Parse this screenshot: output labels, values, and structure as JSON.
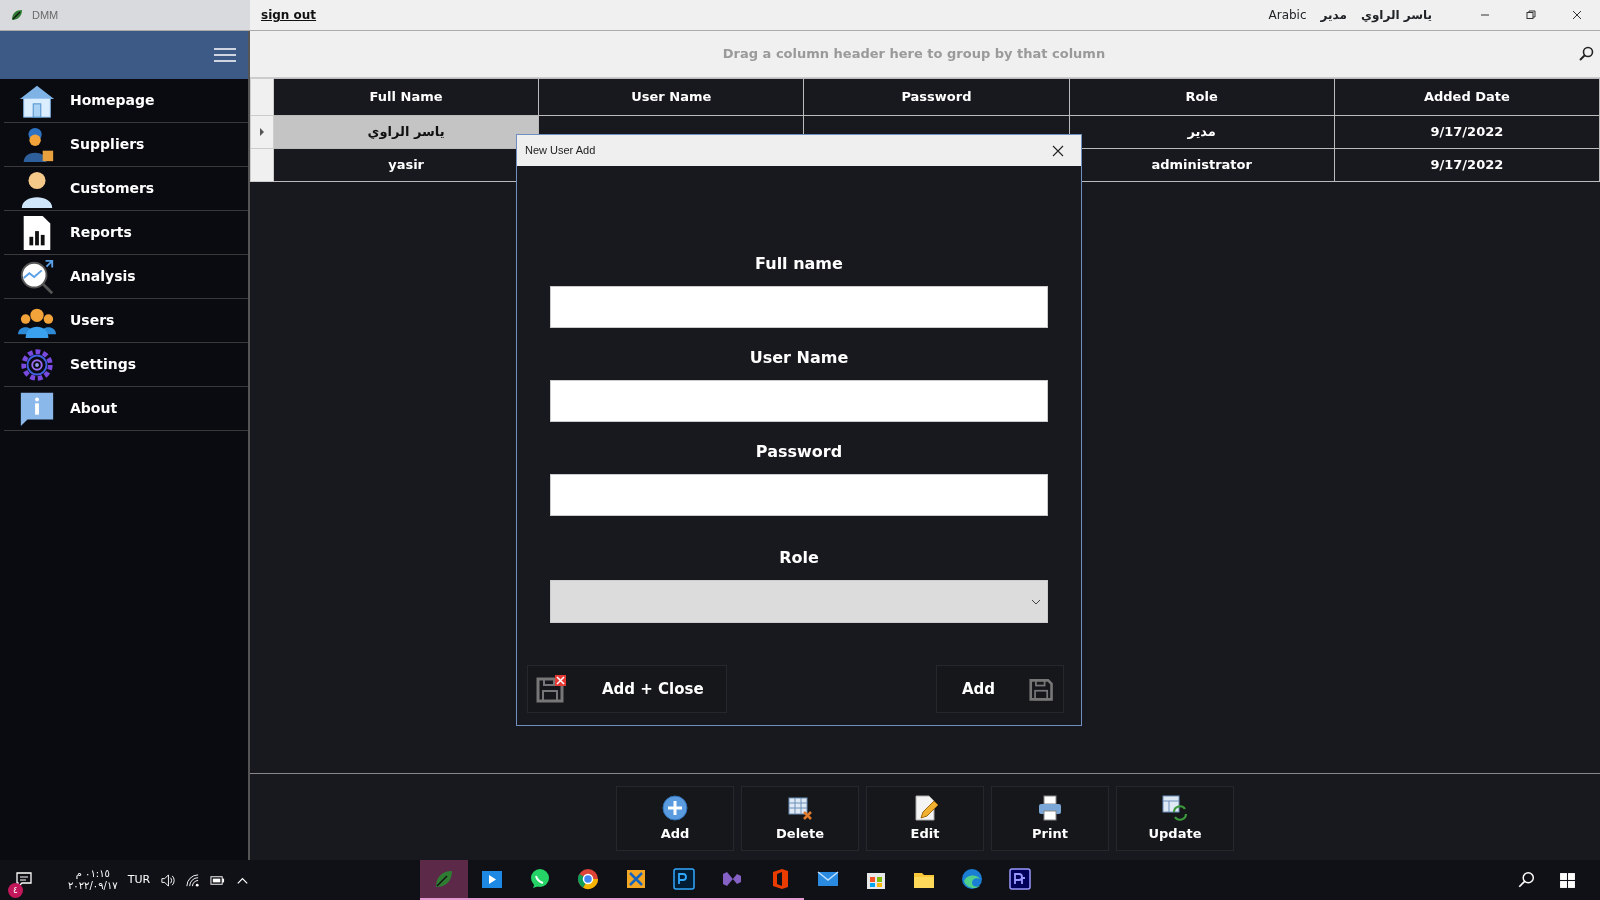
{
  "title_bar": {
    "app_name": "DMM",
    "sign_out": "sign out",
    "language": "Arabic",
    "role": "مدير",
    "user": "ياسر الراوي"
  },
  "sidebar": {
    "items": [
      {
        "label": "Homepage"
      },
      {
        "label": "Suppliers"
      },
      {
        "label": "Customers"
      },
      {
        "label": "Reports"
      },
      {
        "label": "Analysis"
      },
      {
        "label": "Users"
      },
      {
        "label": "Settings"
      },
      {
        "label": "About"
      }
    ]
  },
  "group_panel": {
    "placeholder": "Drag a column header here to group by that column"
  },
  "table": {
    "columns": [
      "Full Name",
      "User Name",
      "Password",
      "Role",
      "Added Date"
    ],
    "rows": [
      {
        "selected": true,
        "cells": [
          "ياسر الراوي",
          null,
          null,
          "مدير",
          "9/17/2022"
        ]
      },
      {
        "selected": false,
        "cells": [
          "yasir",
          null,
          null,
          "administrator",
          "9/17/2022"
        ]
      }
    ]
  },
  "dialog": {
    "title": "New User Add",
    "fields": [
      {
        "label": "Full name",
        "kind": "text"
      },
      {
        "label": "User Name",
        "kind": "text"
      },
      {
        "label": "Password",
        "kind": "text"
      },
      {
        "label": "Role",
        "kind": "select"
      }
    ],
    "buttons": [
      {
        "label": "Add + Close",
        "kind": "add_close"
      },
      {
        "label": "Add",
        "kind": "add"
      }
    ]
  },
  "toolbar": [
    "Add",
    "Delete",
    "Edit",
    "Print",
    "Update"
  ],
  "taskbar": {
    "notification_count": "٤",
    "time": "٠١:١٥ م",
    "date": "٢٠٢٢/٠٩/١٧",
    "language": "TUR",
    "apps": [
      {
        "selected": true,
        "running": true
      },
      {
        "selected": false,
        "running": true
      },
      {
        "selected": false,
        "running": true
      },
      {
        "selected": false,
        "running": true
      },
      {
        "selected": false,
        "running": true
      },
      {
        "selected": false,
        "running": true
      },
      {
        "selected": false,
        "running": true
      },
      {
        "selected": false,
        "running": true
      },
      {
        "selected": false,
        "running": false
      },
      {
        "selected": false,
        "running": false
      },
      {
        "selected": false,
        "running": false
      },
      {
        "selected": false,
        "running": false
      },
      {
        "selected": false,
        "running": false
      }
    ]
  }
}
